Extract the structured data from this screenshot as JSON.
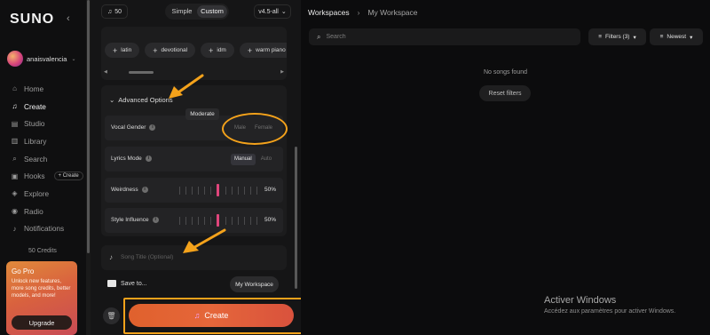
{
  "sidebar": {
    "logo": "SUNO",
    "username": "anaisvalencia",
    "items": [
      {
        "label": "Home",
        "icon": "home-icon",
        "glyph": "⌂"
      },
      {
        "label": "Create",
        "icon": "music-note-icon",
        "glyph": "♫",
        "active": true
      },
      {
        "label": "Studio",
        "icon": "studio-icon",
        "glyph": "▤"
      },
      {
        "label": "Library",
        "icon": "library-icon",
        "glyph": "▥"
      },
      {
        "label": "Search",
        "icon": "search-icon",
        "glyph": "⌕"
      },
      {
        "label": "Hooks",
        "icon": "hooks-icon",
        "glyph": "▣",
        "badge": "+ Create"
      },
      {
        "label": "Explore",
        "icon": "explore-icon",
        "glyph": "◈"
      },
      {
        "label": "Radio",
        "icon": "radio-icon",
        "glyph": "◉"
      },
      {
        "label": "Notifications",
        "icon": "bell-icon",
        "glyph": "♪"
      }
    ],
    "credits": "50 Credits",
    "gopro": {
      "title": "Go Pro",
      "text": "Unlock new features, more song credits, better models, and more!",
      "button": "Upgrade"
    }
  },
  "create": {
    "credits_badge": "50",
    "mode_simple": "Simple",
    "mode_custom": "Custom",
    "version": "v4.5-all",
    "style_tags": [
      "latin",
      "devotional",
      "idm",
      "warm piano"
    ],
    "advanced_label": "Advanced Options",
    "vocal_gender": {
      "label": "Vocal Gender",
      "male": "Male",
      "female": "Female"
    },
    "lyrics_mode": {
      "label": "Lyrics Mode",
      "manual": "Manual",
      "auto": "Auto"
    },
    "weirdness": {
      "label": "Weirdness",
      "value": "50%",
      "level": 0.5
    },
    "style_influence": {
      "label": "Style Influence",
      "value": "50%",
      "level": 0.5
    },
    "tooltip": "Moderate",
    "song_title_placeholder": "Song Title (Optional)",
    "save_to_label": "Save to...",
    "workspace_chip": "My Workspace",
    "create_button": "Create"
  },
  "workspace": {
    "crumb_root": "Workspaces",
    "crumb_current": "My Workspace",
    "search_placeholder": "Search",
    "filters_label": "Filters (3)",
    "sort_label": "Newest",
    "empty_text": "No songs found",
    "reset_label": "Reset filters"
  },
  "watermark": {
    "title": "Activer Windows",
    "subtitle": "Accédez aux paramètres pour activer Windows."
  },
  "colors": {
    "accent": "#e0612d",
    "annotation": "#f4a21b",
    "slider_active": "#e0457b"
  }
}
